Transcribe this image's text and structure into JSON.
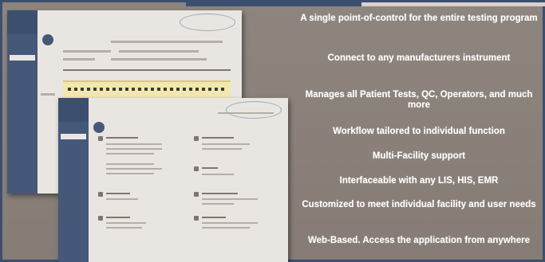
{
  "features": [
    "A single point-of-control for the entire testing program",
    "Connect to any manufacturers instrument",
    "Manages all Patient Tests, QC, Operators, and much more",
    "Workflow tailored to individual function",
    "Multi-Facility support",
    "Interfaceable with any LIS, HIS, EMR",
    "Customized to meet individual facility and user needs",
    "Web-Based. Access the application from anywhere"
  ],
  "colors": {
    "background": "#8a8079",
    "border": "#3d4f6e",
    "sidebar": "#45587a",
    "highlight": "#f2e7b0"
  }
}
